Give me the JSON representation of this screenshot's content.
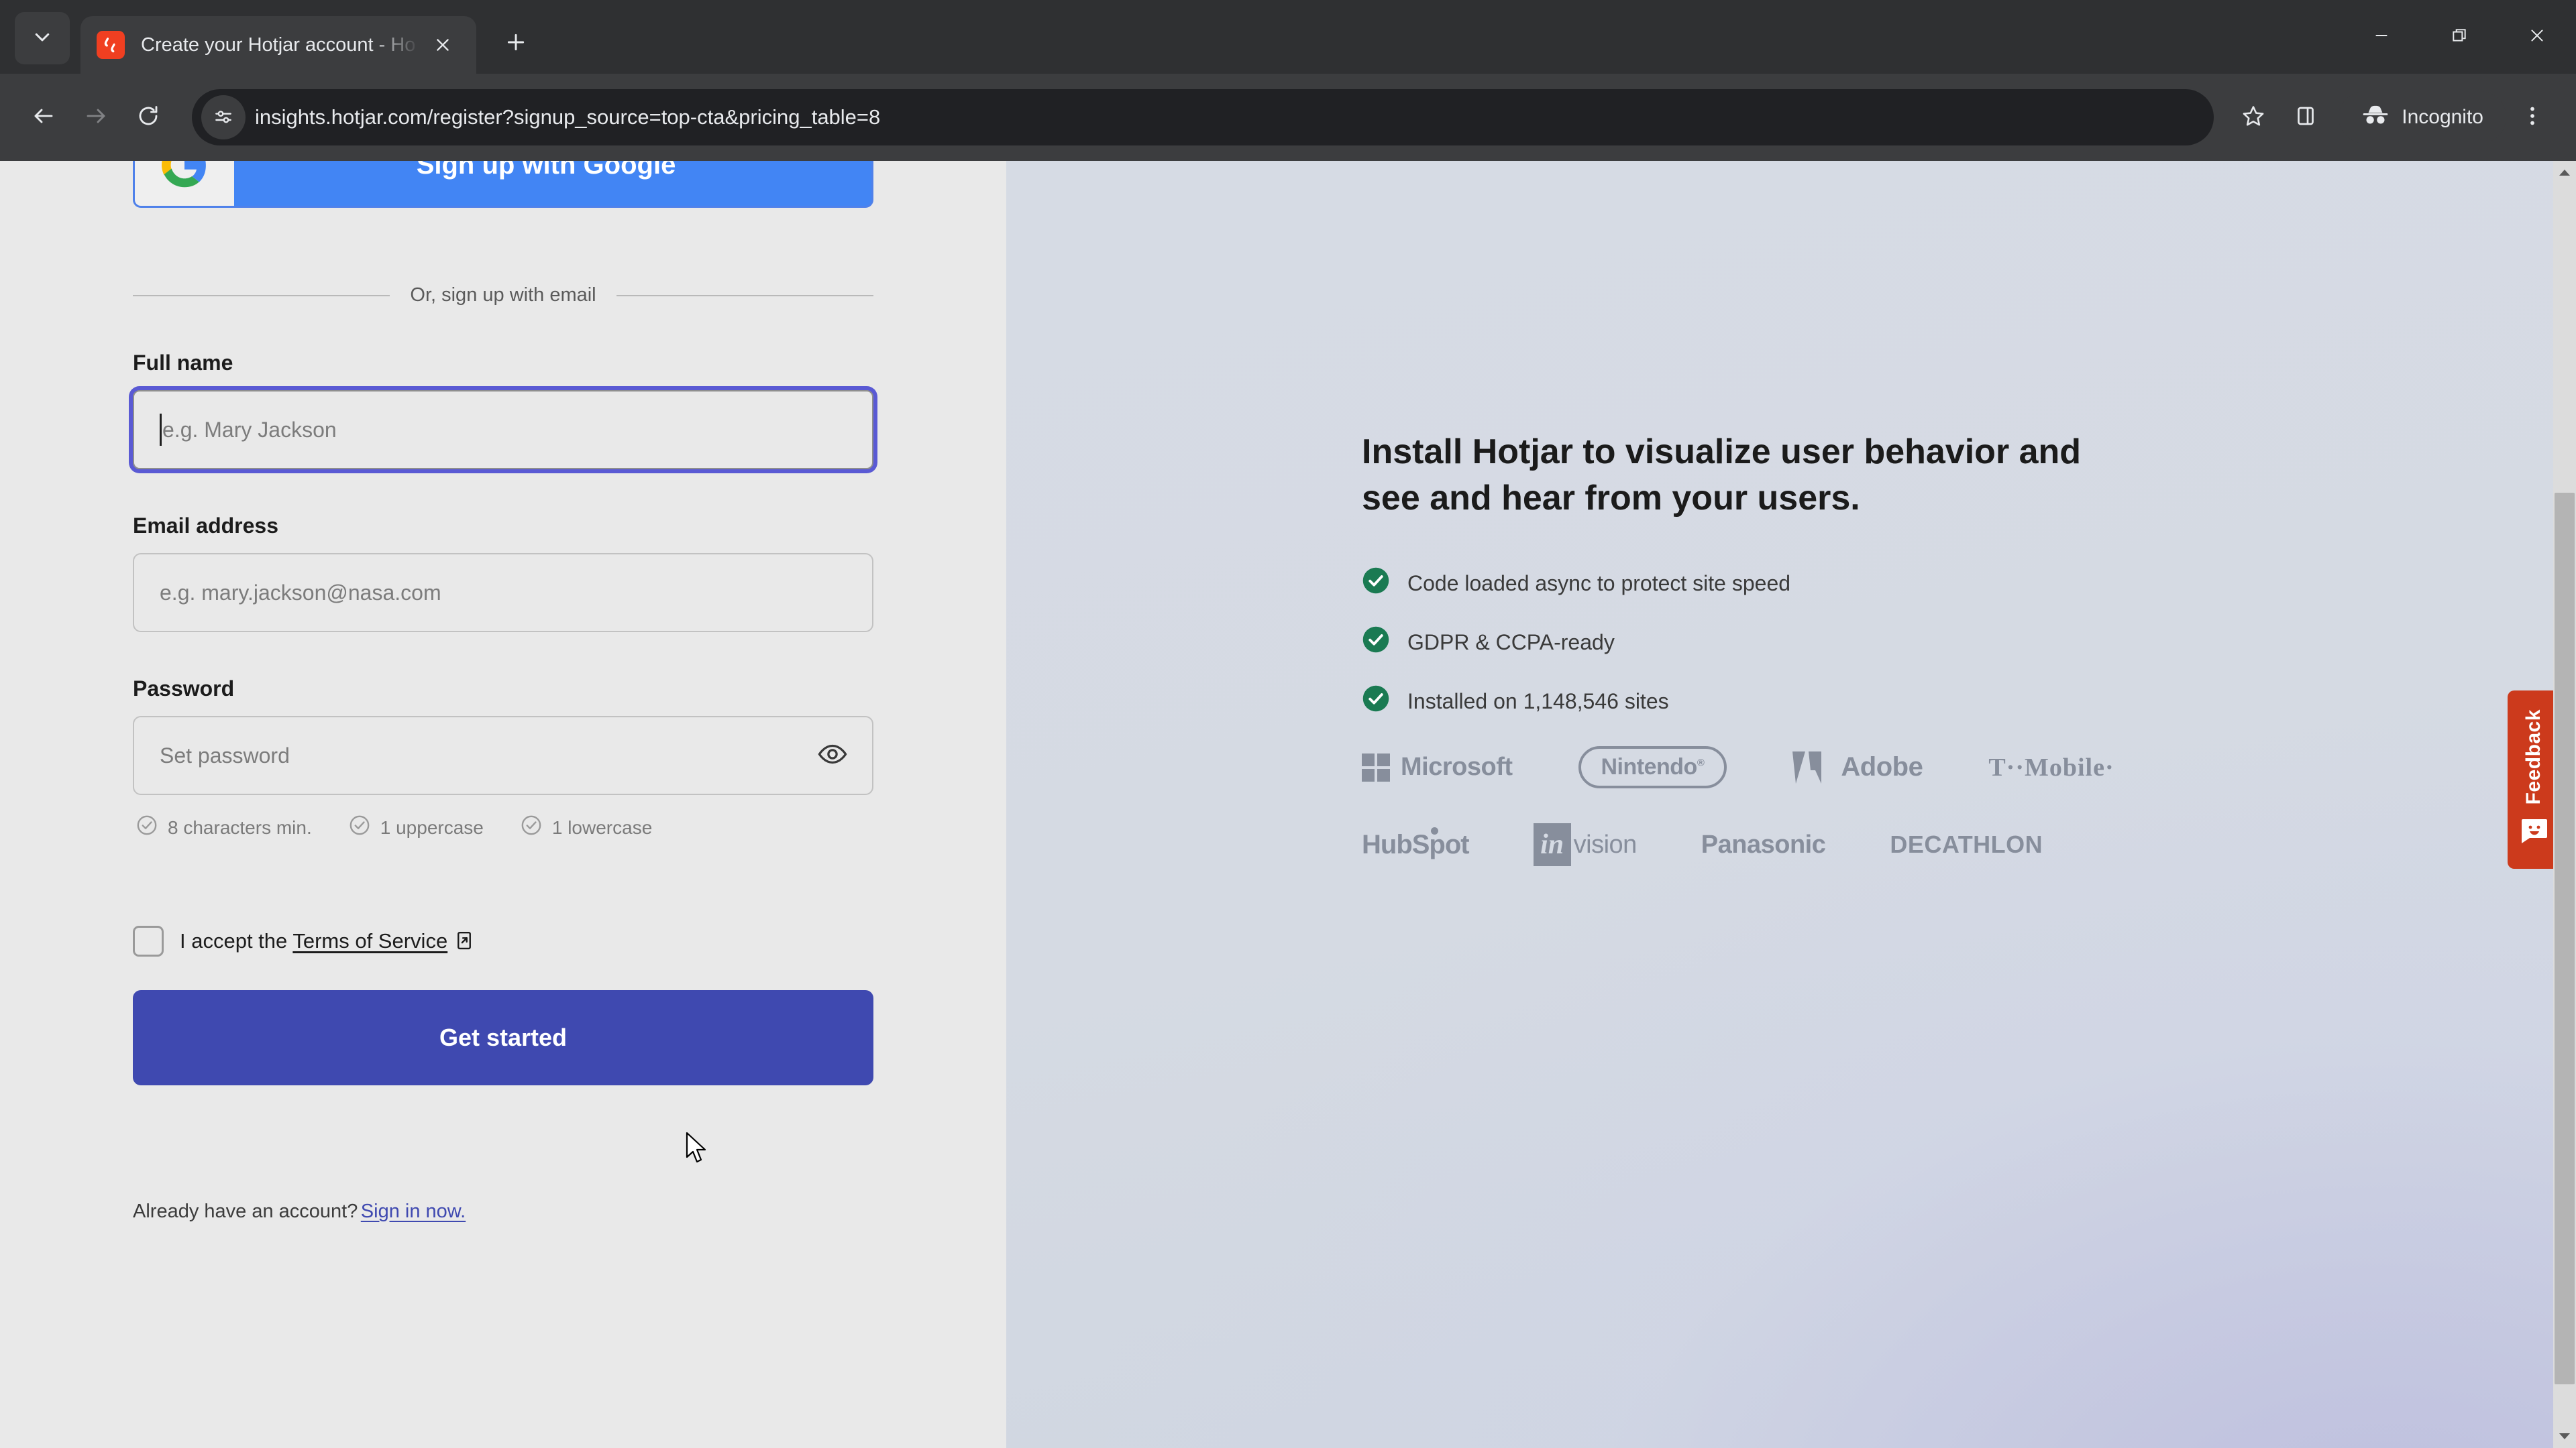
{
  "browser": {
    "tab": {
      "title": "Create your Hotjar account - Ho",
      "favicon_name": "hotjar-favicon"
    },
    "new_tab_label": "+",
    "omnibox": {
      "url": "insights.hotjar.com/register?signup_source=top-cta&pricing_table=8",
      "site_info_icon": "site-settings-icon"
    },
    "incognito_label": "Incognito",
    "icons": {
      "tab_search": "tab-search-chevron-icon",
      "back": "back-arrow-icon",
      "forward": "forward-arrow-icon",
      "reload": "reload-icon",
      "bookmark": "star-icon",
      "side_panel": "side-panel-icon",
      "menu": "kebab-menu-icon",
      "minimize": "minimize-icon",
      "maximize": "restore-window-icon",
      "close": "close-window-icon"
    },
    "accent": "#4285f4",
    "chrome_bg": "#3c3d3f"
  },
  "signup": {
    "google_button": {
      "label": "Sign up with Google",
      "bg": "#4285f4",
      "icon": "google-g-icon"
    },
    "divider_text": "Or, sign up with email",
    "fields": [
      {
        "id": "full-name",
        "label": "Full name",
        "placeholder": "e.g. Mary Jackson",
        "value": "",
        "focused": true
      },
      {
        "id": "email",
        "label": "Email address",
        "placeholder": "e.g. mary.jackson@nasa.com",
        "value": "",
        "focused": false
      },
      {
        "id": "password",
        "label": "Password",
        "placeholder": "Set password",
        "value": "",
        "focused": false
      }
    ],
    "password_rules": [
      "8 characters min.",
      "1 uppercase",
      "1 lowercase"
    ],
    "terms": {
      "prefix": "I accept the",
      "link": "Terms of Service",
      "checked": false
    },
    "cta_label": "Get started",
    "cta_color": "#3f49b0",
    "footer": {
      "text": "Already have an account?",
      "link": "Sign in now."
    }
  },
  "promo": {
    "title": "Install Hotjar to visualize user behavior and see and hear from your users.",
    "bullets": [
      "Code loaded async to protect site speed",
      "GDPR & CCPA-ready",
      "Installed on 1,148,546 sites"
    ],
    "bullet_color": "#1a7a52",
    "logos_row1": [
      "Microsoft",
      "Nintendo",
      "Adobe",
      "T··Mobile·"
    ],
    "logos_row2": [
      "HubSpot",
      "invision",
      "Panasonic",
      "DECATHLON"
    ],
    "panel_bg": "#d6dbe4"
  },
  "feedback": {
    "label": "Feedback",
    "icon": "feedback-smiley-icon",
    "bg": "#cc3a1c"
  }
}
